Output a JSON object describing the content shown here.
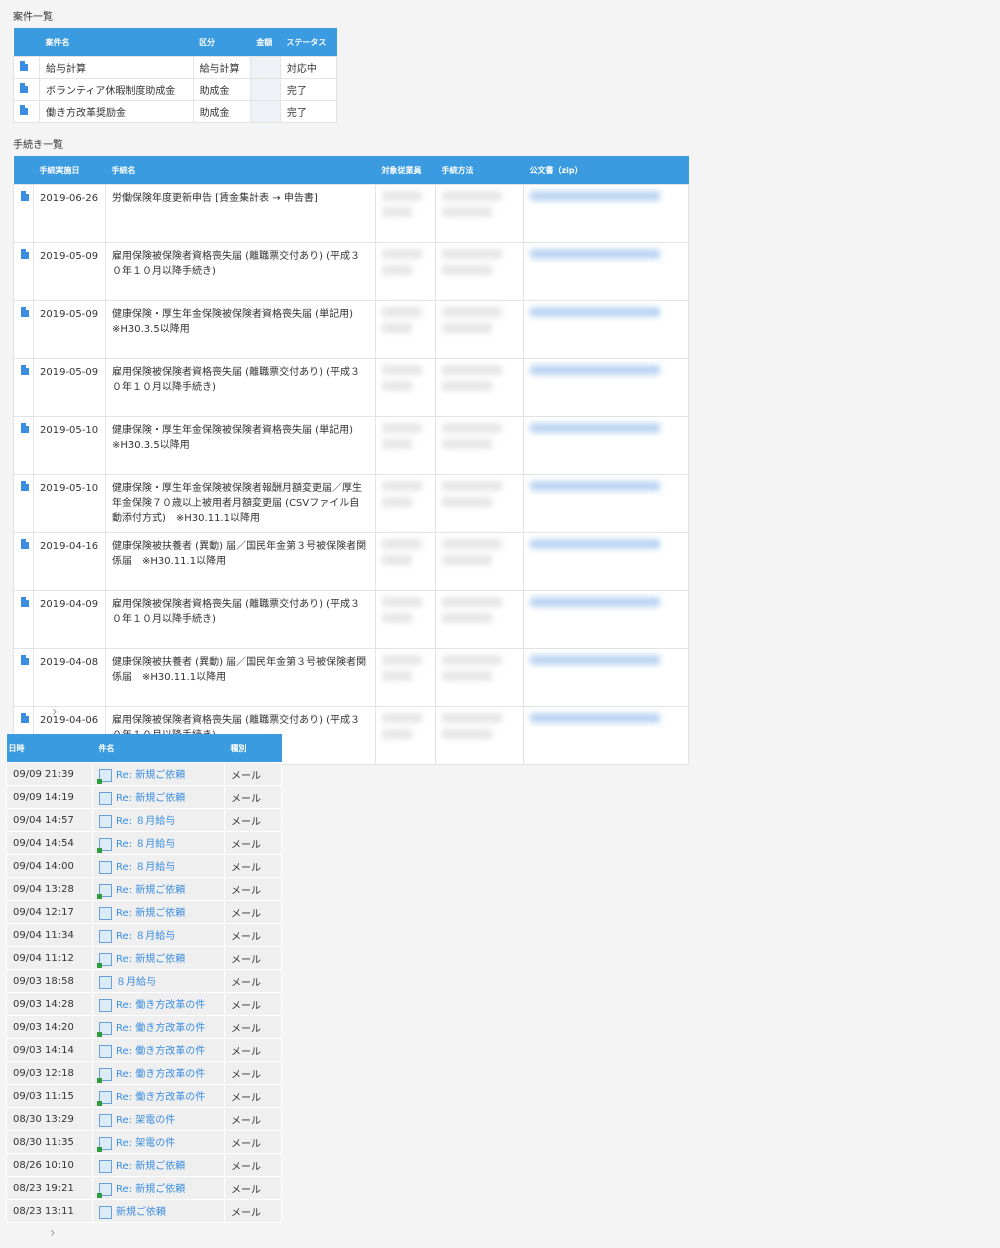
{
  "cases": {
    "title": "案件一覧",
    "headers": [
      "案件名",
      "区分",
      "金額",
      "ステータス"
    ],
    "rows": [
      {
        "name": "給与計算",
        "category": "給与計算",
        "amount": "",
        "status": "対応中"
      },
      {
        "name": "ボランティア休暇制度助成金",
        "category": "助成金",
        "amount": "",
        "status": "完了"
      },
      {
        "name": "働き方改革奨励金",
        "category": "助成金",
        "amount": "",
        "status": "完了"
      }
    ]
  },
  "procedures": {
    "title": "手続き一覧",
    "headers": [
      "手続実施日",
      "手続名",
      "対象従業員",
      "手続方法",
      "公文書（zip）"
    ],
    "rows": [
      {
        "date": "2019-06-26",
        "name": "労働保険年度更新申告 [賃金集計表 → 申告書]"
      },
      {
        "date": "2019-05-09",
        "name": "雇用保険被保険者資格喪失届 (離職票交付あり) (平成３０年１０月以降手続き)"
      },
      {
        "date": "2019-05-09",
        "name": "健康保険・厚生年金保険被保険者資格喪失届 (単記用) ※H30.3.5以降用"
      },
      {
        "date": "2019-05-09",
        "name": "雇用保険被保険者資格喪失届 (離職票交付あり) (平成３０年１０月以降手続き)"
      },
      {
        "date": "2019-05-10",
        "name": "健康保険・厚生年金保険被保険者資格喪失届 (単記用) ※H30.3.5以降用"
      },
      {
        "date": "2019-05-10",
        "name": "健康保険・厚生年金保険被保険者報酬月額変更届／厚生年金保険７０歳以上被用者月額変更届 (CSVファイル自動添付方式)　※H30.11.1以降用"
      },
      {
        "date": "2019-04-16",
        "name": "健康保険被扶養者 (異動) 届／国民年金第３号被保険者関係届　※H30.11.1以降用"
      },
      {
        "date": "2019-04-09",
        "name": "雇用保険被保険者資格喪失届 (離職票交付あり) (平成３０年１０月以降手続き)"
      },
      {
        "date": "2019-04-08",
        "name": "健康保険被扶養者 (異動) 届／国民年金第３号被保険者関係届　※H30.11.1以降用"
      },
      {
        "date": "2019-04-06",
        "name": "雇用保険被保険者資格喪失届 (離職票交付あり) (平成３０年１０月以降手続き)"
      }
    ],
    "pager_next": "›"
  },
  "messages": {
    "headers": [
      "日時",
      "件名",
      "種別"
    ],
    "rows": [
      {
        "time": "09/09 21:39",
        "subject": "Re: 新規ご依頼",
        "type": "メール",
        "icon": "mail-arrow-icon"
      },
      {
        "time": "09/09 14:19",
        "subject": "Re: 新規ご依頼",
        "type": "メール",
        "icon": "mail-icon"
      },
      {
        "time": "09/04 14:57",
        "subject": "Re: ８月給与",
        "type": "メール",
        "icon": "mail-icon"
      },
      {
        "time": "09/04 14:54",
        "subject": "Re: ８月給与",
        "type": "メール",
        "icon": "mail-arrow-icon"
      },
      {
        "time": "09/04 14:00",
        "subject": "Re: ８月給与",
        "type": "メール",
        "icon": "mail-icon"
      },
      {
        "time": "09/04 13:28",
        "subject": "Re: 新規ご依頼",
        "type": "メール",
        "icon": "mail-arrow-icon"
      },
      {
        "time": "09/04 12:17",
        "subject": "Re: 新規ご依頼",
        "type": "メール",
        "icon": "mail-icon"
      },
      {
        "time": "09/04 11:34",
        "subject": "Re: ８月給与",
        "type": "メール",
        "icon": "mail-icon"
      },
      {
        "time": "09/04 11:12",
        "subject": "Re: 新規ご依頼",
        "type": "メール",
        "icon": "mail-arrow-icon"
      },
      {
        "time": "09/03 18:58",
        "subject": "８月給与",
        "type": "メール",
        "icon": "mail-icon"
      },
      {
        "time": "09/03 14:28",
        "subject": "Re: 働き方改革の件",
        "type": "メール",
        "icon": "mail-icon"
      },
      {
        "time": "09/03 14:20",
        "subject": "Re: 働き方改革の件",
        "type": "メール",
        "icon": "mail-arrow-icon"
      },
      {
        "time": "09/03 14:14",
        "subject": "Re: 働き方改革の件",
        "type": "メール",
        "icon": "mail-icon"
      },
      {
        "time": "09/03 12:18",
        "subject": "Re: 働き方改革の件",
        "type": "メール",
        "icon": "mail-arrow-icon"
      },
      {
        "time": "09/03 11:15",
        "subject": "Re: 働き方改革の件",
        "type": "メール",
        "icon": "mail-arrow-icon"
      },
      {
        "time": "08/30 13:29",
        "subject": "Re: 架電の件",
        "type": "メール",
        "icon": "mail-icon"
      },
      {
        "time": "08/30 11:35",
        "subject": "Re: 架電の件",
        "type": "メール",
        "icon": "mail-arrow-icon"
      },
      {
        "time": "08/26 10:10",
        "subject": "Re: 新規ご依頼",
        "type": "メール",
        "icon": "mail-icon"
      },
      {
        "time": "08/23 19:21",
        "subject": "Re: 新規ご依頼",
        "type": "メール",
        "icon": "mail-arrow-icon"
      },
      {
        "time": "08/23 13:11",
        "subject": "新規ご依頼",
        "type": "メール",
        "icon": "mail-icon"
      }
    ],
    "pager_next": "›"
  }
}
